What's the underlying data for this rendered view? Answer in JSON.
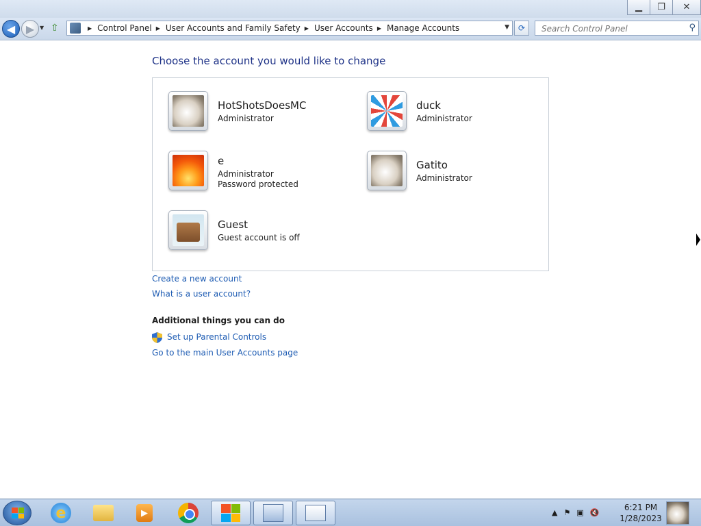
{
  "window": {
    "minimize_glyph": "▁",
    "restore_glyph": "❐",
    "close_glyph": "✕"
  },
  "nav": {
    "back_glyph": "◀",
    "forward_glyph": "▶",
    "breadcrumbs": [
      "Control Panel",
      "User Accounts and Family Safety",
      "User Accounts",
      "Manage Accounts"
    ],
    "search_placeholder": "Search Control Panel"
  },
  "main": {
    "heading": "Choose the account you would like to change",
    "accounts": [
      {
        "name": "HotShotsDoesMC",
        "lines": [
          "Administrator"
        ],
        "picture_icon": "kitten-picture-icon"
      },
      {
        "name": "duck",
        "lines": [
          "Administrator"
        ],
        "picture_icon": "pinwheel-picture-icon"
      },
      {
        "name": "e",
        "lines": [
          "Administrator",
          "Password protected"
        ],
        "picture_icon": "flower-picture-icon"
      },
      {
        "name": "Gatito",
        "lines": [
          "Administrator"
        ],
        "picture_icon": "kitten-picture-icon"
      },
      {
        "name": "Guest",
        "lines": [
          "Guest account is off"
        ],
        "picture_icon": "suitcase-picture-icon"
      }
    ],
    "links": {
      "create": "Create a new account",
      "what_is": "What is a user account?"
    },
    "additional": {
      "heading": "Additional things you can do",
      "parental": "Set up Parental Controls",
      "main_page": "Go to the main User Accounts page"
    }
  },
  "taskbar": {
    "time": "6:21 PM",
    "date": "1/28/2023",
    "apps": [
      "internet-explorer-icon",
      "windows-explorer-icon",
      "media-player-icon",
      "chrome-icon",
      "windows-icon",
      "control-panel-icon",
      "document-icon"
    ]
  },
  "colors": {
    "link": "#1e5cb3",
    "heading": "#1e3287"
  }
}
